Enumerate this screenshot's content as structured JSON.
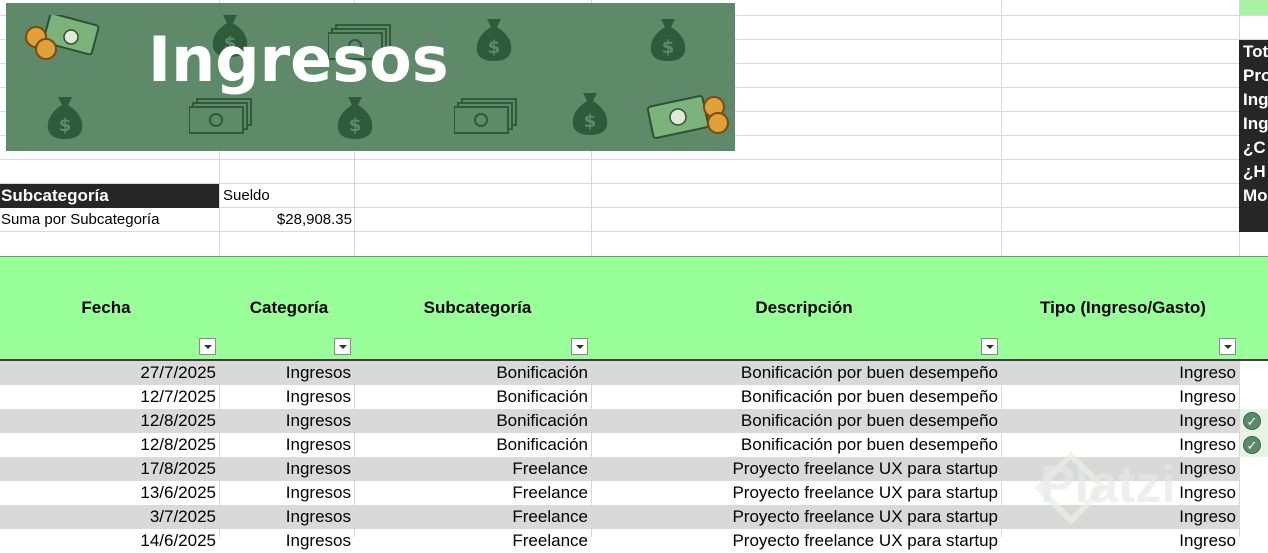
{
  "banner": {
    "title": "Ingresos"
  },
  "side_panel": {
    "lines": [
      "Tot",
      "Pro",
      "Ing",
      "Ing",
      "¿C",
      "¿H",
      "Mo"
    ]
  },
  "filter_box": {
    "subcategory_label": "Subcategoría",
    "subcategory_value": "Sueldo",
    "sum_label": "Suma por Subcategoría",
    "sum_value": "$28,908.35"
  },
  "table": {
    "headers": [
      "Fecha",
      "Categoría",
      "Subcategoría",
      "Descripción",
      "Tipo (Ingreso/Gasto)"
    ],
    "rows": [
      {
        "fecha": "27/7/2025",
        "categoria": "Ingresos",
        "subcategoria": "Bonificación",
        "descripcion": "Bonificación por buen desempeño",
        "tipo": "Ingreso",
        "check": false
      },
      {
        "fecha": "12/7/2025",
        "categoria": "Ingresos",
        "subcategoria": "Bonificación",
        "descripcion": "Bonificación por buen desempeño",
        "tipo": "Ingreso",
        "check": false
      },
      {
        "fecha": "12/8/2025",
        "categoria": "Ingresos",
        "subcategoria": "Bonificación",
        "descripcion": "Bonificación por buen desempeño",
        "tipo": "Ingreso",
        "check": true
      },
      {
        "fecha": "12/8/2025",
        "categoria": "Ingresos",
        "subcategoria": "Bonificación",
        "descripcion": "Bonificación por buen desempeño",
        "tipo": "Ingreso",
        "check": true
      },
      {
        "fecha": "17/8/2025",
        "categoria": "Ingresos",
        "subcategoria": "Freelance",
        "descripcion": "Proyecto freelance UX para startup",
        "tipo": "Ingreso",
        "check": false
      },
      {
        "fecha": "13/6/2025",
        "categoria": "Ingresos",
        "subcategoria": "Freelance",
        "descripcion": "Proyecto freelance UX para startup",
        "tipo": "Ingreso",
        "check": false
      },
      {
        "fecha": "3/7/2025",
        "categoria": "Ingresos",
        "subcategoria": "Freelance",
        "descripcion": "Proyecto freelance UX para startup",
        "tipo": "Ingreso",
        "check": false
      },
      {
        "fecha": "14/6/2025",
        "categoria": "Ingresos",
        "subcategoria": "Freelance",
        "descripcion": "Proyecto freelance UX para startup",
        "tipo": "Ingreso",
        "check": false
      }
    ]
  },
  "watermark": "Platzi",
  "colors": {
    "banner": "#5e8a6a",
    "header_band": "#99ff99",
    "dark_cell": "#262626",
    "row_shade": "#d9d9d9"
  }
}
